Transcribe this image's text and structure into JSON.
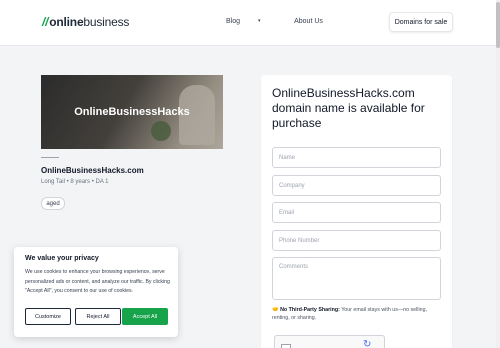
{
  "header": {
    "logo_slash": "//",
    "logo_part1": "online",
    "logo_part2": "business",
    "nav": [
      {
        "label": "Blog",
        "has_dropdown": true
      },
      {
        "label": "About Us",
        "has_dropdown": false
      }
    ],
    "cta_label": "Domains for sale",
    "chevron_icon": "chevron-down-icon"
  },
  "listing": {
    "hero_title": "OnlineBusinessHacks",
    "domain": "OnlineBusinessHacks.com",
    "meta": [
      "Long Tail",
      "8 years",
      "DA 1"
    ],
    "meta_separator": "•",
    "tag": "aged"
  },
  "form": {
    "heading": "OnlineBusinessHacks.com domain name is available for purchase",
    "name_placeholder": "Name",
    "company_placeholder": "Company",
    "email_placeholder": "Email",
    "phone_placeholder": "Phone Number",
    "comments_placeholder": "Comments",
    "note_icon": "handshake-icon",
    "note_bold": "No Third-Party Sharing:",
    "note_text": " Your email stays with us—no selling, renting, or sharing."
  },
  "cookie": {
    "title": "We value your privacy",
    "text": "We use cookies to enhance your browsing experience, serve personalized ads or content, and analyze our traffic. By clicking \"Accept All\", you consent to our use of cookies.",
    "customize_label": "Customize",
    "reject_label": "Reject All",
    "accept_label": "Accept All"
  },
  "colors": {
    "brand_green": "#16a34a",
    "page_bg": "#f3f4f6"
  }
}
